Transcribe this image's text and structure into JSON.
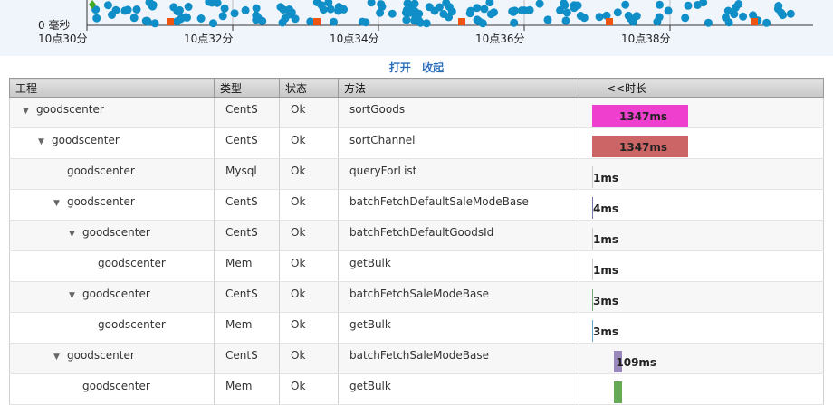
{
  "chart": {
    "y_label": "0 毫秒",
    "x_ticks": [
      "10点30分",
      "10点32分",
      "10点34分",
      "10点36分",
      "10点38分"
    ]
  },
  "toggle": {
    "open": "打开",
    "collapse": "收起"
  },
  "table": {
    "headers": {
      "project": "工程",
      "type": "类型",
      "status": "状态",
      "method": "方法",
      "duration": "<<时长"
    },
    "rows": [
      {
        "project": "goodscenter",
        "type": "CentS",
        "status": "Ok",
        "method": "sortGoods",
        "duration": "1347ms",
        "depth": 0,
        "expandable": true,
        "bar_color": "#ee3fcf",
        "bar_start": 0.0,
        "bar_fraction": 1.0
      },
      {
        "project": "goodscenter",
        "type": "CentS",
        "status": "Ok",
        "method": "sortChannel",
        "duration": "1347ms",
        "depth": 1,
        "expandable": true,
        "bar_color": "#cc6666",
        "bar_start": 0.0,
        "bar_fraction": 1.0
      },
      {
        "project": "goodscenter",
        "type": "Mysql",
        "status": "Ok",
        "method": "queryForList",
        "duration": "1ms",
        "depth": 2,
        "expandable": false,
        "bar_color": "#cccccc",
        "bar_start": 0.0,
        "bar_fraction": 0.0
      },
      {
        "project": "goodscenter",
        "type": "CentS",
        "status": "Ok",
        "method": "batchFetchDefaultSaleModeBase",
        "duration": "4ms",
        "depth": 2,
        "expandable": true,
        "bar_color": "#7777aa",
        "bar_start": 0.0,
        "bar_fraction": 0.003
      },
      {
        "project": "goodscenter",
        "type": "CentS",
        "status": "Ok",
        "method": "batchFetchDefaultGoodsId",
        "duration": "1ms",
        "depth": 3,
        "expandable": true,
        "bar_color": "#cccccc",
        "bar_start": 0.0,
        "bar_fraction": 0.0
      },
      {
        "project": "goodscenter",
        "type": "Mem",
        "status": "Ok",
        "method": "getBulk",
        "duration": "1ms",
        "depth": 4,
        "expandable": false,
        "bar_color": "#cccccc",
        "bar_start": 0.0,
        "bar_fraction": 0.0
      },
      {
        "project": "goodscenter",
        "type": "CentS",
        "status": "Ok",
        "method": "batchFetchSaleModeBase",
        "duration": "3ms",
        "depth": 3,
        "expandable": true,
        "bar_color": "#77aa77",
        "bar_start": 0.0,
        "bar_fraction": 0.002
      },
      {
        "project": "goodscenter",
        "type": "Mem",
        "status": "Ok",
        "method": "getBulk",
        "duration": "3ms",
        "depth": 4,
        "expandable": false,
        "bar_color": "#66aacc",
        "bar_start": 0.0,
        "bar_fraction": 0.002
      },
      {
        "project": "goodscenter",
        "type": "CentS",
        "status": "Ok",
        "method": "batchFetchSaleModeBase",
        "duration": "109ms",
        "depth": 2,
        "expandable": true,
        "bar_color": "#9988bb",
        "bar_start": 0.23,
        "bar_fraction": 0.08
      },
      {
        "project": "goodscenter",
        "type": "Mem",
        "status": "Ok",
        "method": "getBulk",
        "duration": "",
        "depth": 3,
        "expandable": false,
        "bar_color": "#66aa55",
        "bar_start": 0.23,
        "bar_fraction": 0.08
      }
    ]
  },
  "colors": {
    "dot": "#0f8ec7",
    "marker": "#ee5511",
    "green": "#44aa22",
    "header": "#cccccc"
  }
}
